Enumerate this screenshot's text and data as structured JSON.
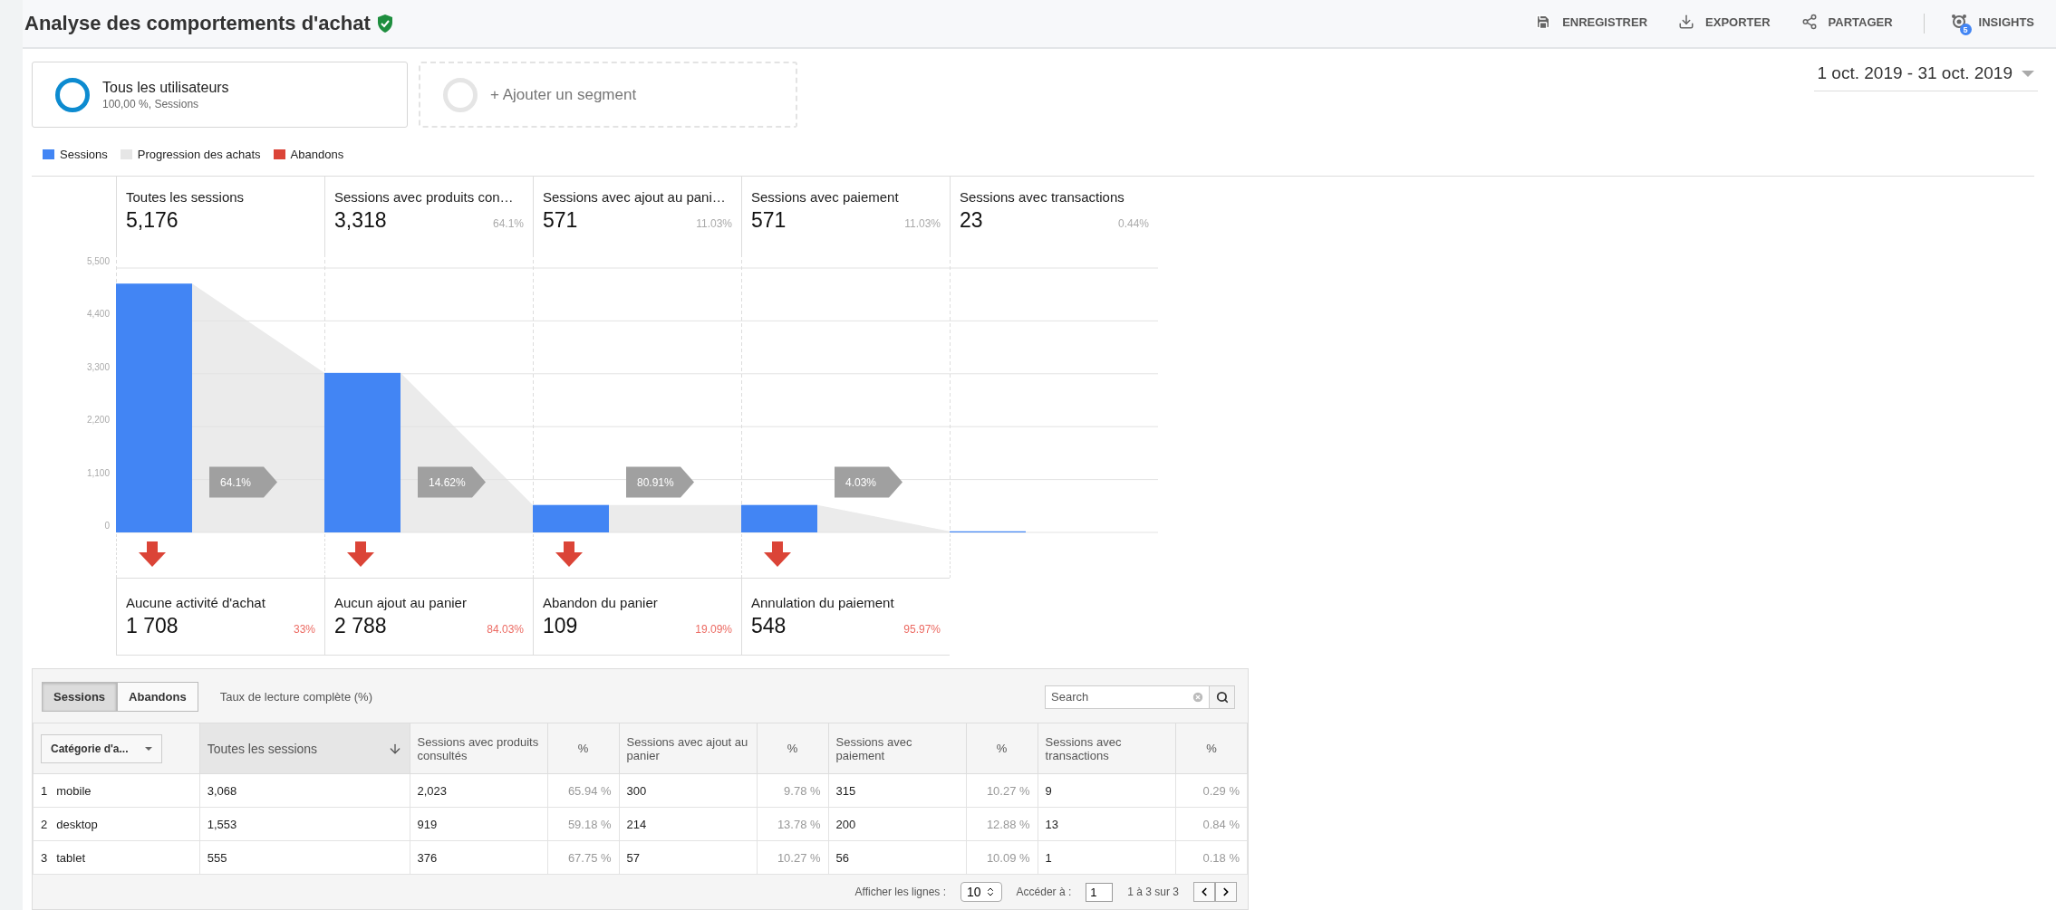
{
  "header": {
    "title": "Analyse des comportements d'achat",
    "actions": [
      {
        "kind": "save",
        "label": "ENREGISTRER"
      },
      {
        "kind": "export",
        "label": "EXPORTER"
      },
      {
        "kind": "share",
        "label": "PARTAGER"
      },
      {
        "kind": "insights",
        "label": "INSIGHTS",
        "badge": "5"
      }
    ]
  },
  "segments": [
    {
      "kind": "active",
      "title": "Tous les utilisateurs",
      "subtitle": "100,00 %, Sessions"
    },
    {
      "kind": "add",
      "title": "+ Ajouter un segment"
    }
  ],
  "date_range": "1 oct. 2019 - 31 oct. 2019",
  "legend": [
    {
      "label": "Sessions",
      "color": "#4285f4"
    },
    {
      "label": "Progression des achats",
      "color": "#e6e6e6"
    },
    {
      "label": "Abandons",
      "color": "#db4437"
    }
  ],
  "steps": [
    {
      "label": "Toutes les sessions",
      "value": "5,176",
      "progress": "64.1%",
      "drop": {
        "label": "Aucune activité d'achat",
        "value": "1 708",
        "percent": "33%"
      }
    },
    {
      "label": "Sessions avec produits con…",
      "value": "3,318",
      "percent": "64.1%",
      "progress": "14.62%",
      "drop": {
        "label": "Aucun ajout au panier",
        "value": "2 788",
        "percent": "84.03%"
      }
    },
    {
      "label": "Sessions avec ajout au pani…",
      "value": "571",
      "percent": "11.03%",
      "progress": "80.91%",
      "drop": {
        "label": "Abandon du panier",
        "value": "109",
        "percent": "19.09%"
      }
    },
    {
      "label": "Sessions avec paiement",
      "value": "571",
      "percent": "11.03%",
      "progress": "4.03%",
      "drop": {
        "label": "Annulation du paiement",
        "value": "548",
        "percent": "95.97%"
      }
    },
    {
      "label": "Sessions avec transactions",
      "value": "23",
      "percent": "0.44%"
    }
  ],
  "chart_data": {
    "type": "bar",
    "grid": true,
    "values": [
      5176,
      3318,
      571,
      571,
      23
    ],
    "ylim": [
      0,
      5500
    ],
    "yticks": [
      {
        "value": 0,
        "label": "0"
      },
      {
        "value": 1100,
        "label": "1,100"
      },
      {
        "value": 2200,
        "label": "2,200"
      },
      {
        "value": 3300,
        "label": "3,300"
      },
      {
        "value": 4400,
        "label": "4,400"
      },
      {
        "value": 5500,
        "label": "5,500"
      }
    ]
  },
  "table": {
    "toggles": [
      {
        "label": "Sessions",
        "selected": true
      },
      {
        "label": "Abandons",
        "selected": false
      }
    ],
    "metric_label": "Taux de lecture complète (%)",
    "search": {
      "placeholder": "Search"
    },
    "dimension": "Catégorie d'a...",
    "columns": [
      {
        "label": "Toutes les sessions",
        "sorted": true
      },
      {
        "label": "Sessions avec produits consultés",
        "sorted": false
      },
      {
        "label": "%",
        "sorted": false
      },
      {
        "label": "Sessions avec ajout au panier",
        "sorted": false
      },
      {
        "label": "%",
        "sorted": false
      },
      {
        "label": "Sessions avec paiement",
        "sorted": false
      },
      {
        "label": "%",
        "sorted": false
      },
      {
        "label": "Sessions avec transactions",
        "sorted": false
      },
      {
        "label": "%",
        "sorted": false
      }
    ],
    "rows": [
      {
        "index": "1",
        "name": "mobile",
        "cells": [
          "3,068",
          "2,023",
          "65.94 %",
          "300",
          "9.78 %",
          "315",
          "10.27 %",
          "9",
          "0.29 %"
        ]
      },
      {
        "index": "2",
        "name": "desktop",
        "cells": [
          "1,553",
          "919",
          "59.18 %",
          "214",
          "13.78 %",
          "200",
          "12.88 %",
          "13",
          "0.84 %"
        ]
      },
      {
        "index": "3",
        "name": "tablet",
        "cells": [
          "555",
          "376",
          "67.75 %",
          "57",
          "10.27 %",
          "56",
          "10.09 %",
          "1",
          "0.18 %"
        ]
      }
    ],
    "footer": {
      "rows_label": "Afficher les lignes :",
      "rows_value": "10",
      "goto_label": "Accéder à :",
      "goto_value": "1",
      "range": "1 à 3 sur 3"
    }
  }
}
